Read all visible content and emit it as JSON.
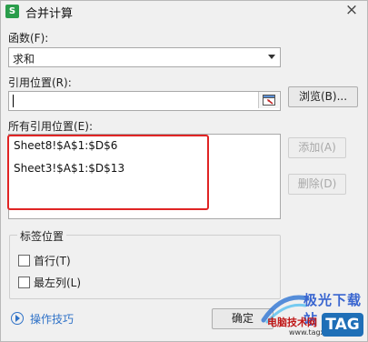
{
  "window": {
    "app_icon_letter": "S",
    "title": "合并计算",
    "close_glyph": "×"
  },
  "function": {
    "label": "函数(F):",
    "selected": "求和"
  },
  "reference": {
    "label": "引用位置(R):",
    "value": "",
    "browse_label": "浏览(B)..."
  },
  "all_references": {
    "label": "所有引用位置(E):",
    "items": [
      "Sheet8!$A$1:$D$6",
      "Sheet3!$A$1:$D$13"
    ],
    "add_label": "添加(A)",
    "delete_label": "删除(D)"
  },
  "label_position": {
    "title": "标签位置",
    "first_row": "首行(T)",
    "left_column": "最左列(L)"
  },
  "footer": {
    "help_label": "操作技巧",
    "ok_label": "确定"
  },
  "watermark": {
    "brand": "极光下载站",
    "subtitle": "电脑技术网",
    "url": "www.tagxp.com",
    "tag": "TAG"
  },
  "colors": {
    "highlight": "#e02424",
    "link": "#2f72c7",
    "app_icon": "#2a9d4b"
  }
}
